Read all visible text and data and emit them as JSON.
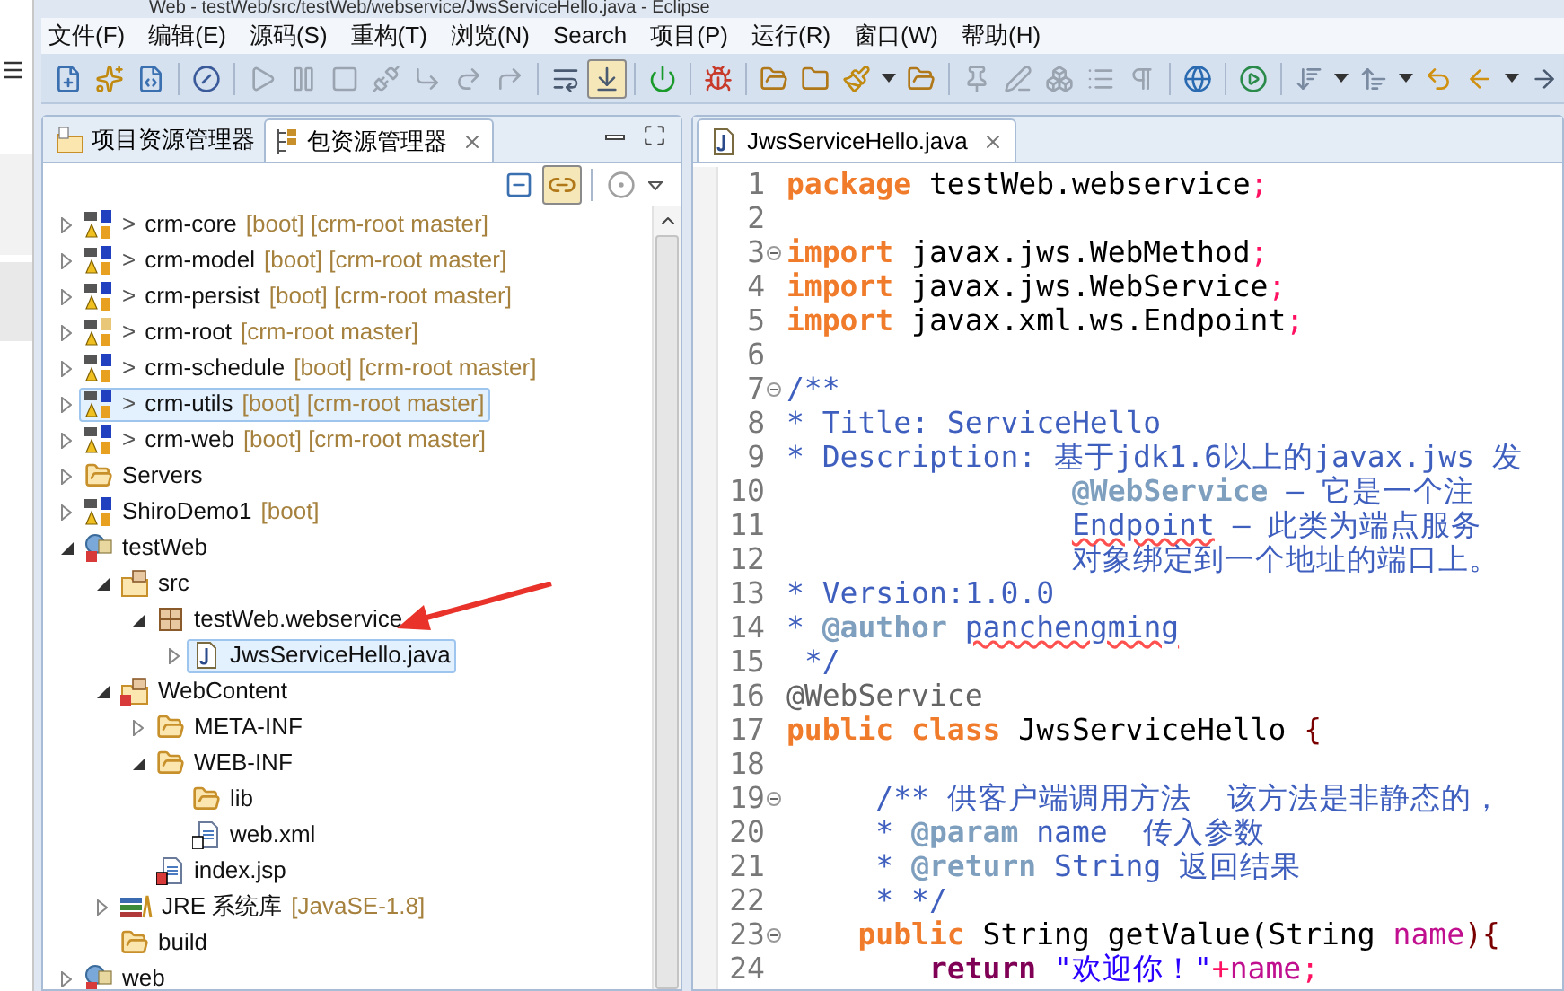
{
  "window": {
    "title": "Web - testWeb/src/testWeb/webservice/JwsServiceHello.java - Eclipse"
  },
  "menu": [
    "文件(F)",
    "编辑(E)",
    "源码(S)",
    "重构(T)",
    "浏览(N)",
    "Search",
    "项目(P)",
    "运行(R)",
    "窗口(W)",
    "帮助(H)"
  ],
  "toolbar": [
    {
      "kind": "new",
      "pressed": false
    },
    {
      "kind": "wizard",
      "pressed": false
    },
    {
      "kind": "new-class",
      "pressed": false
    },
    {
      "kind": "sep"
    },
    {
      "kind": "skip",
      "pressed": false
    },
    {
      "kind": "sep"
    },
    {
      "kind": "resume",
      "pressed": false
    },
    {
      "kind": "suspend",
      "pressed": false
    },
    {
      "kind": "terminate",
      "pressed": false
    },
    {
      "kind": "disconnect",
      "pressed": false
    },
    {
      "kind": "step-into",
      "pressed": false
    },
    {
      "kind": "step-over",
      "pressed": false
    },
    {
      "kind": "step-return",
      "pressed": false
    },
    {
      "kind": "sep"
    },
    {
      "kind": "wrap",
      "pressed": false
    },
    {
      "kind": "filter",
      "pressed": true
    },
    {
      "kind": "sep"
    },
    {
      "kind": "power",
      "pressed": false
    },
    {
      "kind": "sep"
    },
    {
      "kind": "bug",
      "pressed": false
    },
    {
      "kind": "sep"
    },
    {
      "kind": "open-folder",
      "pressed": false
    },
    {
      "kind": "folder",
      "pressed": false
    },
    {
      "kind": "brush",
      "pressed": false
    },
    {
      "kind": "dropdown",
      "pressed": false
    },
    {
      "kind": "open-folder",
      "pressed": false
    },
    {
      "kind": "sep"
    },
    {
      "kind": "pin",
      "pressed": false
    },
    {
      "kind": "pen",
      "pressed": false
    },
    {
      "kind": "blocks",
      "pressed": false
    },
    {
      "kind": "list",
      "pressed": false
    },
    {
      "kind": "pilcrow",
      "pressed": false
    },
    {
      "kind": "sep"
    },
    {
      "kind": "globe",
      "pressed": false
    },
    {
      "kind": "sep"
    },
    {
      "kind": "run",
      "pressed": false
    },
    {
      "kind": "sep"
    },
    {
      "kind": "next-annotation",
      "pressed": false
    },
    {
      "kind": "dropdown",
      "pressed": false
    },
    {
      "kind": "prev-annotation",
      "pressed": false
    },
    {
      "kind": "dropdown",
      "pressed": false
    },
    {
      "kind": "last-edit",
      "pressed": false
    },
    {
      "kind": "back",
      "pressed": false
    },
    {
      "kind": "dropdown",
      "pressed": false
    },
    {
      "kind": "forward",
      "pressed": false
    }
  ],
  "explorer": {
    "tabs": [
      {
        "label": "项目资源管理器",
        "kind": "project-explorer",
        "selected": false
      },
      {
        "label": "包资源管理器",
        "kind": "package-explorer",
        "selected": true
      }
    ],
    "view_toolbar": [
      {
        "kind": "collapse-all",
        "pressed": false
      },
      {
        "kind": "link-editor",
        "pressed": true
      },
      {
        "kind": "sep"
      },
      {
        "kind": "focus",
        "pressed": false
      },
      {
        "kind": "view-menu",
        "pressed": false
      }
    ],
    "tree": [
      {
        "label": "crm-core",
        "git": ">",
        "decoration": "[boot] [crm-root master]",
        "kind": "maven-project",
        "expanded": false,
        "selected": false
      },
      {
        "label": "crm-model",
        "git": ">",
        "decoration": "[boot] [crm-root master]",
        "kind": "maven-project",
        "expanded": false,
        "selected": false
      },
      {
        "label": "crm-persist",
        "git": ">",
        "decoration": "[boot] [crm-root master]",
        "kind": "maven-project",
        "expanded": false,
        "selected": false
      },
      {
        "label": "crm-root",
        "git": ">",
        "decoration": "[crm-root master]",
        "kind": "maven-parent",
        "expanded": false,
        "selected": false
      },
      {
        "label": "crm-schedule",
        "git": ">",
        "decoration": "[boot] [crm-root master]",
        "kind": "maven-project",
        "expanded": false,
        "selected": false
      },
      {
        "label": "crm-utils",
        "git": ">",
        "decoration": "[boot] [crm-root master]",
        "kind": "maven-project",
        "expanded": false,
        "selected": true
      },
      {
        "label": "crm-web",
        "git": ">",
        "decoration": "[boot] [crm-root master]",
        "kind": "maven-project",
        "expanded": false,
        "selected": false
      },
      {
        "label": "Servers",
        "kind": "folder",
        "expanded": false,
        "selected": false
      },
      {
        "label": "ShiroDemo1",
        "decoration": "[boot]",
        "kind": "maven-project",
        "expanded": false,
        "selected": false
      },
      {
        "label": "testWeb",
        "kind": "web-project",
        "expanded": true,
        "selected": false,
        "children": [
          {
            "label": "src",
            "kind": "source-folder",
            "expanded": true,
            "selected": false,
            "children": [
              {
                "label": "testWeb.webservice",
                "kind": "package",
                "expanded": true,
                "selected": false,
                "children": [
                  {
                    "label": "JwsServiceHello.java",
                    "kind": "java-file",
                    "expanded": false,
                    "selected": true
                  }
                ]
              }
            ]
          },
          {
            "label": "WebContent",
            "kind": "web-folder",
            "expanded": true,
            "selected": false,
            "children": [
              {
                "label": "META-INF",
                "kind": "folder",
                "expanded": false,
                "selected": false
              },
              {
                "label": "WEB-INF",
                "kind": "folder",
                "expanded": true,
                "selected": false,
                "children": [
                  {
                    "label": "lib",
                    "kind": "folder",
                    "selected": false
                  },
                  {
                    "label": "web.xml",
                    "kind": "xml-file",
                    "selected": false
                  }
                ]
              },
              {
                "label": "index.jsp",
                "kind": "jsp-file",
                "selected": false
              }
            ]
          },
          {
            "label": "JRE 系统库",
            "decoration": "[JavaSE-1.8]",
            "kind": "library",
            "expanded": false,
            "selected": false
          },
          {
            "label": "build",
            "kind": "folder",
            "selected": false
          }
        ]
      },
      {
        "label": "web",
        "kind": "web-project",
        "expanded": false,
        "selected": false
      }
    ]
  },
  "editor": {
    "tab": {
      "label": "JwsServiceHello.java",
      "selected": true
    },
    "lines": [
      {
        "number": "1",
        "fold": false,
        "segments": [
          {
            "kind": "kw",
            "text": "package"
          },
          {
            "kind": "text",
            "text": " testWeb.webservice"
          },
          {
            "kind": "punct",
            "text": ";"
          }
        ]
      },
      {
        "number": "2",
        "fold": false
      },
      {
        "number": "3",
        "fold": true,
        "segments": [
          {
            "kind": "kw",
            "text": "import"
          },
          {
            "kind": "text",
            "text": " javax.jws.WebMethod"
          },
          {
            "kind": "punct",
            "text": ";"
          }
        ]
      },
      {
        "number": "4",
        "fold": false,
        "segments": [
          {
            "kind": "kw",
            "text": "import"
          },
          {
            "kind": "text",
            "text": " javax.jws.WebService"
          },
          {
            "kind": "punct",
            "text": ";"
          }
        ]
      },
      {
        "number": "5",
        "fold": false,
        "segments": [
          {
            "kind": "kw",
            "text": "import"
          },
          {
            "kind": "text",
            "text": " javax.xml.ws.Endpoint"
          },
          {
            "kind": "punct",
            "text": ";"
          }
        ]
      },
      {
        "number": "6",
        "fold": false
      },
      {
        "number": "7",
        "fold": true,
        "segments": [
          {
            "kind": "doc",
            "text": "/**"
          }
        ]
      },
      {
        "number": "8",
        "fold": false,
        "segments": [
          {
            "kind": "doc",
            "text": "* Title: ServiceHello"
          }
        ]
      },
      {
        "number": "9",
        "fold": false,
        "segments": [
          {
            "kind": "doc",
            "text": "* Description: 基于jdk1.6以上的javax.jws 发"
          }
        ]
      },
      {
        "number": "10",
        "fold": false,
        "segments": [
          {
            "kind": "doctag",
            "text": "                @WebService"
          },
          {
            "kind": "doc",
            "text": " — 它是一个注"
          }
        ]
      },
      {
        "number": "11",
        "fold": false,
        "segments": [
          {
            "kind": "misspelled",
            "text": "                Endpoint"
          },
          {
            "kind": "doc",
            "text": " – 此类为端点服务"
          }
        ]
      },
      {
        "number": "12",
        "fold": false,
        "segments": [
          {
            "kind": "doc",
            "text": "                对象绑定到一个地址的端口上。"
          }
        ]
      },
      {
        "number": "13",
        "fold": false,
        "segments": [
          {
            "kind": "doc",
            "text": "* Version:1.0.0"
          }
        ]
      },
      {
        "number": "14",
        "fold": false,
        "segments": [
          {
            "kind": "doc",
            "text": "* "
          },
          {
            "kind": "doctag",
            "text": "@author"
          },
          {
            "kind": "misspelled",
            "text": " panchengming"
          }
        ]
      },
      {
        "number": "15",
        "fold": false,
        "segments": [
          {
            "kind": "doc",
            "text": " */"
          }
        ]
      },
      {
        "number": "16",
        "fold": false,
        "segments": [
          {
            "kind": "ann",
            "text": "@WebService"
          }
        ]
      },
      {
        "number": "17",
        "fold": false,
        "segments": [
          {
            "kind": "kw",
            "text": "public class"
          },
          {
            "kind": "text",
            "text": " JwsServiceHello "
          },
          {
            "kind": "brace",
            "text": "{"
          }
        ]
      },
      {
        "number": "18",
        "fold": false
      },
      {
        "number": "19",
        "fold": true,
        "segments": [
          {
            "kind": "doc",
            "text": "     /** 供客户端调用方法  该方法是非静态的，"
          }
        ]
      },
      {
        "number": "20",
        "fold": false,
        "segments": [
          {
            "kind": "doc",
            "text": "     * "
          },
          {
            "kind": "doctag",
            "text": "@param"
          },
          {
            "kind": "doc",
            "text": " name  传入参数"
          }
        ]
      },
      {
        "number": "21",
        "fold": false,
        "segments": [
          {
            "kind": "doc",
            "text": "     * "
          },
          {
            "kind": "doctag",
            "text": "@return"
          },
          {
            "kind": "doc",
            "text": " String 返回结果"
          }
        ]
      },
      {
        "number": "22",
        "fold": false,
        "segments": [
          {
            "kind": "doc",
            "text": "     * */"
          }
        ]
      },
      {
        "number": "23",
        "fold": true,
        "segments": [
          {
            "kind": "kw",
            "text": "    public"
          },
          {
            "kind": "text",
            "text": " String getValue(String "
          },
          {
            "kind": "var",
            "text": "name"
          },
          {
            "kind": "brace",
            "text": "){"
          }
        ]
      },
      {
        "number": "24",
        "fold": false,
        "segments": [
          {
            "kind": "kw2",
            "text": "        return"
          },
          {
            "kind": "str",
            "text": " \"欢迎你！\""
          },
          {
            "kind": "punct",
            "text": "+"
          },
          {
            "kind": "var",
            "text": "name"
          },
          {
            "kind": "punct",
            "text": ";"
          }
        ]
      }
    ]
  }
}
